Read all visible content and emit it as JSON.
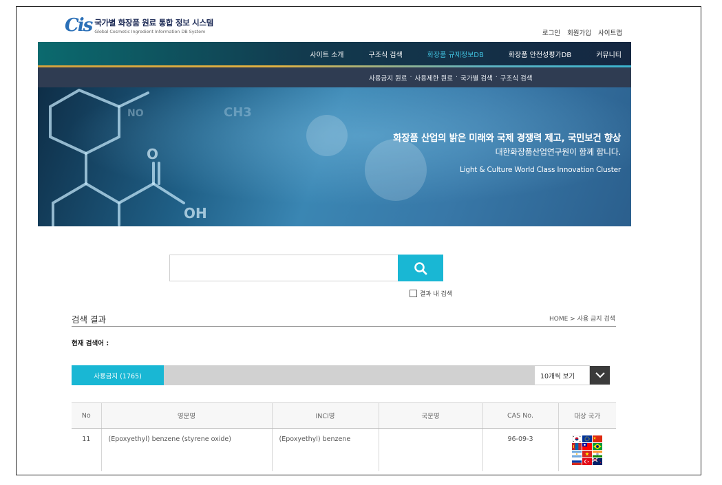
{
  "header": {
    "logo_mark": "Cis",
    "logo_title": "국가별 화장품 원료 통합 정보 시스템",
    "logo_subtitle": "Global Cosmetic Ingredient Information DB System",
    "util_links": [
      "로그인",
      "회원가입",
      "사이트맵"
    ]
  },
  "gnb": {
    "items": [
      "사이트 소개",
      "구조식 검색",
      "화장품 규제정보DB",
      "화장품 안전성평가DB",
      "커뮤니티"
    ],
    "active_index": 2
  },
  "lnb": {
    "items": [
      "사용금지 원료",
      "사용제한 원료",
      "국가별 검색",
      "구조식 검색"
    ],
    "separator": "·"
  },
  "hero": {
    "line1": "화장품 산업의 밝은 미래와 국제 경쟁력 제고, 국민보건 향상",
    "line2": "대한화장품산업연구원이 함께 합니다.",
    "line3": "Light & Culture World Class Innovation Cluster"
  },
  "search": {
    "value": "",
    "icon": "search-icon",
    "in_result_label": "결과 내 검색",
    "in_result_checked": false
  },
  "results": {
    "title": "검색 결과",
    "breadcrumb": "HOME > 사용 금지 검색",
    "current_term_label": "현재 검색어 :",
    "tab_label": "사용금지 (1765)",
    "per_page": "10개씩 보기",
    "columns": [
      "No",
      "영문명",
      "INCI명",
      "국문명",
      "CAS No.",
      "대상 국가"
    ],
    "rows": [
      {
        "no": "11",
        "english": "(Epoxyethyl) benzene (styrene oxide)",
        "inci": "(Epoxyethyl) benzene",
        "korean": "",
        "cas": "96-09-3"
      }
    ]
  },
  "colors": {
    "accent": "#19b7d4",
    "nav_active": "#41c2e0",
    "nav_bg": "#152741",
    "subnav_bg": "#2f3c52"
  }
}
